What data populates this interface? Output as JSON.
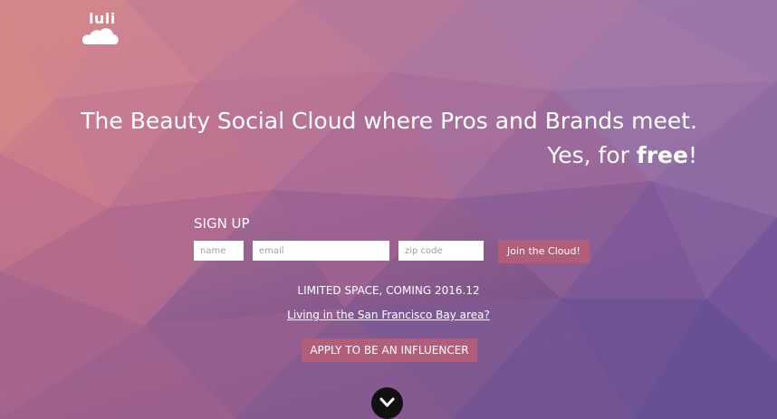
{
  "brand": {
    "logo_text": "luli",
    "logo_icon": "cloud-icon"
  },
  "hero": {
    "headline_line1": "The Beauty Social Cloud where Pros and Brands meet.",
    "headline_line2_prefix": "Yes, for ",
    "headline_line2_bold": "free",
    "headline_line2_suffix": "!"
  },
  "signup": {
    "title": "SIGN UP",
    "name_placeholder": "name",
    "email_placeholder": "email",
    "zip_placeholder": "zip code",
    "join_label": "Join the Cloud!"
  },
  "notice": {
    "limited_text": "LIMITED SPACE, COMING 2016.12",
    "bay_link_text": "Living in the San Francisco Bay area?",
    "apply_label": "APPLY TO BE AN INFLUENCER"
  },
  "scroll": {
    "icon": "chevron-down-icon"
  },
  "colors": {
    "accent_button": "#b05e7a",
    "text": "#ffffff",
    "scroll_button": "#111111"
  }
}
